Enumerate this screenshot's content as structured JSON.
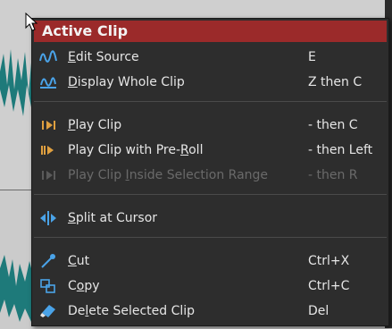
{
  "menu": {
    "title": "Active Clip",
    "items": [
      {
        "label_pre": "",
        "label_u": "E",
        "label_post": "dit Source",
        "shortcut": "E",
        "icon": "waveform-icon",
        "enabled": true
      },
      {
        "label_pre": "",
        "label_u": "D",
        "label_post": "isplay Whole Clip",
        "shortcut": "Z then C",
        "icon": "display-clip-icon",
        "enabled": true
      },
      {
        "label_pre": "",
        "label_u": "P",
        "label_post": "lay Clip",
        "shortcut": "- then C",
        "icon": "play-clip-icon",
        "enabled": true
      },
      {
        "label_pre": "Play Clip with Pre-",
        "label_u": "R",
        "label_post": "oll",
        "shortcut": "- then Left",
        "icon": "play-preroll-icon",
        "enabled": true
      },
      {
        "label_pre": "Play Clip ",
        "label_u": "I",
        "label_post": "nside Selection Range",
        "shortcut": "- then R",
        "icon": "play-selection-icon",
        "enabled": false
      },
      {
        "label_pre": "",
        "label_u": "S",
        "label_post": "plit at Cursor",
        "shortcut": "",
        "icon": "split-icon",
        "enabled": true
      },
      {
        "label_pre": "",
        "label_u": "C",
        "label_post": "ut",
        "shortcut": "Ctrl+X",
        "icon": "cut-icon",
        "enabled": true
      },
      {
        "label_pre": "C",
        "label_u": "o",
        "label_post": "py",
        "shortcut": "Ctrl+C",
        "icon": "copy-icon",
        "enabled": true
      },
      {
        "label_pre": "De",
        "label_u": "l",
        "label_post": "ete Selected Clip",
        "shortcut": "Del",
        "icon": "eraser-icon",
        "enabled": true
      }
    ]
  },
  "colors": {
    "title_bar": "#9b2a2a",
    "menu_bg": "#2d2d2d",
    "icon_blue": "#4aa3e8",
    "icon_orange": "#e0a040",
    "waveform": "#1e7a7a"
  }
}
